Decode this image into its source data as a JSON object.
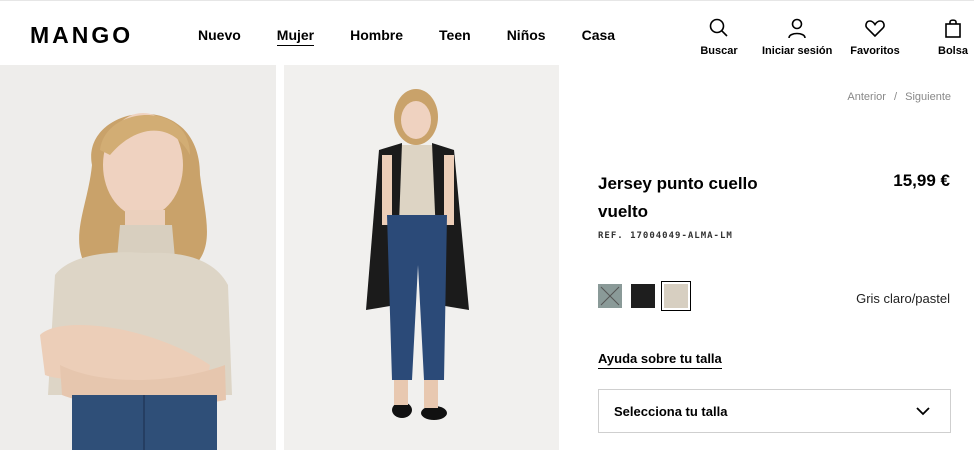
{
  "header": {
    "logo": "MANGO",
    "nav": [
      "Nuevo",
      "Mujer",
      "Hombre",
      "Teen",
      "Niños",
      "Casa"
    ],
    "active_nav": "Mujer",
    "actions": {
      "search": "Buscar",
      "login": "Iniciar sesión",
      "favorites": "Favoritos",
      "bag": "Bolsa"
    }
  },
  "breadcrumb": {
    "prev": "Anterior",
    "separator": "/",
    "next": "Siguiente"
  },
  "product": {
    "title": "Jersey punto cuello vuelto",
    "price": "15,99 €",
    "ref": "REF. 17004049-ALMA-LM",
    "colors": [
      {
        "name": "gray",
        "hex": "#8a9a98"
      },
      {
        "name": "black",
        "hex": "#1e1e1e"
      },
      {
        "name": "cream",
        "hex": "#d7cfc1"
      }
    ],
    "selected_color_name": "Gris claro/pastel",
    "size_help": "Ayuda sobre tu talla",
    "size_select": "Selecciona tu talla"
  }
}
